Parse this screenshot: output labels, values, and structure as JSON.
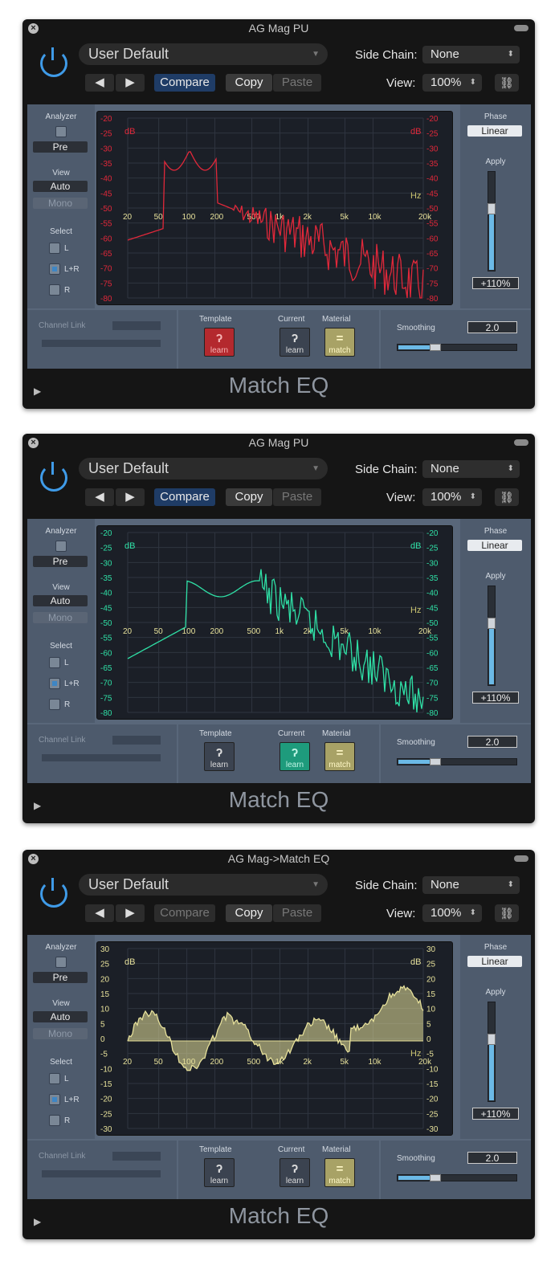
{
  "common": {
    "preset": "User Default",
    "side_chain_label": "Side Chain:",
    "side_chain_value": "None",
    "view_label": "View:",
    "view_value": "100%",
    "compare": "Compare",
    "copy": "Copy",
    "paste": "Paste",
    "analyzer": "Analyzer",
    "analyzer_mode": "Pre",
    "view": "View",
    "view_mode": "Auto",
    "channel_mode": "Mono",
    "select": "Select",
    "sel_l": "L",
    "sel_lr": "L+R",
    "sel_r": "R",
    "phase": "Phase",
    "phase_value": "Linear",
    "apply": "Apply",
    "apply_value": "+110%",
    "apply_level": 1.1,
    "channel_link": "Channel Link",
    "template": "Template",
    "current": "Current",
    "material": "Material",
    "learn": "learn",
    "match": "match",
    "smoothing": "Smoothing",
    "smoothing_value": "2.0",
    "plugin_name": "Match EQ",
    "db": "dB",
    "hz": "Hz",
    "freq_labels": [
      "20",
      "50",
      "100",
      "200",
      "500",
      "1k",
      "2k",
      "5k",
      "10k",
      "20k"
    ],
    "level_labels": [
      "-20",
      "-25",
      "-30",
      "-35",
      "-40",
      "-45",
      "-50",
      "-55",
      "-60",
      "-65",
      "-70",
      "-75",
      "-80"
    ],
    "eq_labels": [
      "30",
      "25",
      "20",
      "15",
      "10",
      "5",
      "0",
      "-5",
      "-10",
      "-15",
      "-20",
      "-25",
      "-30"
    ]
  },
  "windows": [
    {
      "title": "AG Mag PU",
      "compare_active": true,
      "template_active": true,
      "current_active": false,
      "curve_color": "#e0283a"
    },
    {
      "title": "AG Mag PU",
      "compare_active": true,
      "template_active": false,
      "current_active": true,
      "curve_color": "#2fe0a6"
    },
    {
      "title": "AG Mag->Match EQ",
      "compare_active": false,
      "template_active": false,
      "current_active": false,
      "curve_color": "#e6e09a"
    }
  ],
  "colors": {
    "accent": "#3f9be8",
    "panel": "#59677a"
  }
}
